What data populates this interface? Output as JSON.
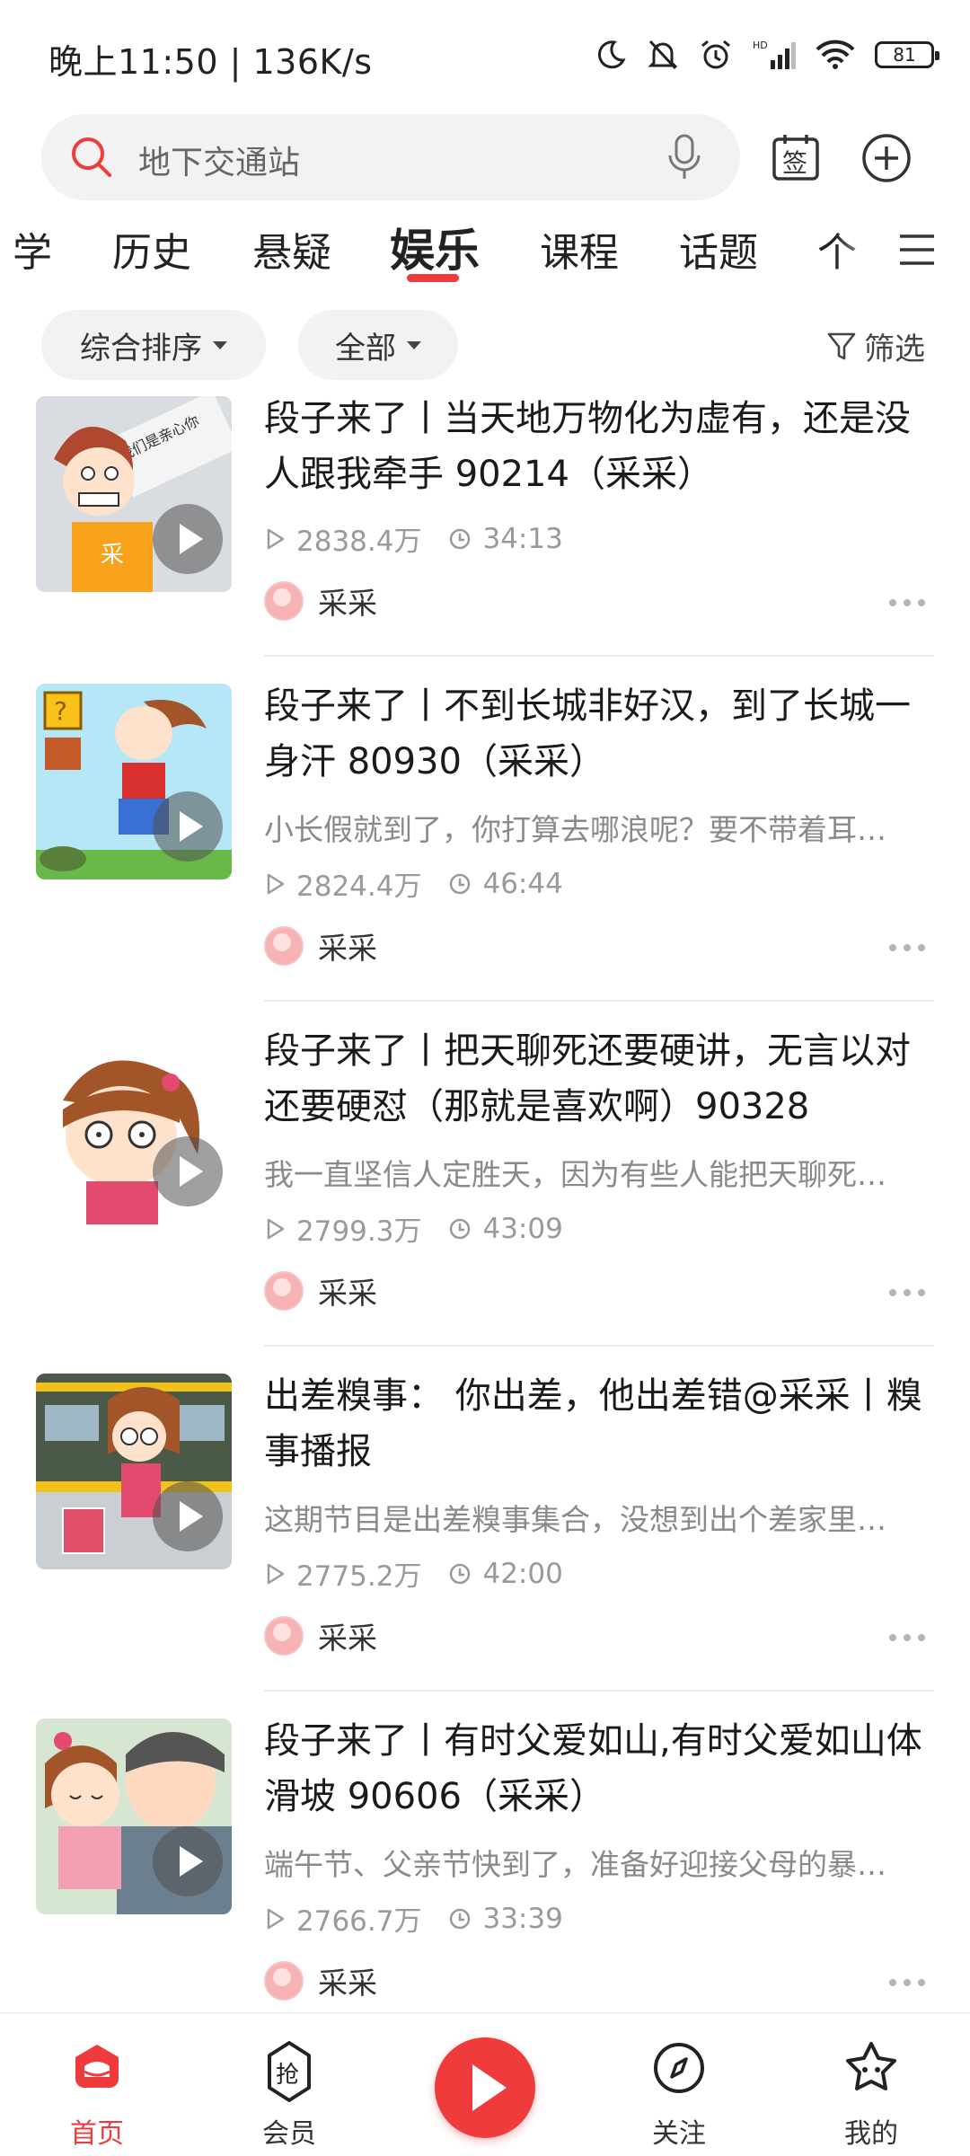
{
  "status_bar": {
    "time_speed": "晚上11:50 | 136K/s",
    "battery": "81",
    "icons": [
      "moon-icon",
      "bell-off-icon",
      "alarm-icon",
      "hd-signal-icon",
      "wifi-icon",
      "battery-icon"
    ]
  },
  "search": {
    "placeholder": "地下交通站",
    "icons": [
      "search-icon",
      "mic-icon",
      "sign-in-icon",
      "add-icon"
    ],
    "sign_label": "签"
  },
  "tabs": {
    "items": [
      "学",
      "历史",
      "悬疑",
      "娱乐",
      "课程",
      "话题",
      "个"
    ],
    "active": "娱乐",
    "accent": "#ef3b3b"
  },
  "filters": {
    "sort": "综合排序",
    "scope": "全部",
    "filter": "筛选"
  },
  "feed": {
    "items": [
      {
        "title": "段子来了丨当天地万物化为虚有，还是没人跟我牵手 90214（采采）",
        "desc": "",
        "plays": "2838.4万",
        "duration": "34:13",
        "author": "采采"
      },
      {
        "title": "段子来了丨不到长城非好汉，到了长城一身汗 80930（采采）",
        "desc": "小长假就到了，你打算去哪浪呢？要不带着耳…",
        "plays": "2824.4万",
        "duration": "46:44",
        "author": "采采"
      },
      {
        "title": "段子来了丨把天聊死还要硬讲，无言以对还要硬怼（那就是喜欢啊）90328",
        "desc": "我一直坚信人定胜天，因为有些人能把天聊死…",
        "plays": "2799.3万",
        "duration": "43:09",
        "author": "采采"
      },
      {
        "title": "出差糗事： 你出差，他出差错@采采丨糗事播报",
        "desc": "这期节目是出差糗事集合，没想到出个差家里…",
        "plays": "2775.2万",
        "duration": "42:00",
        "author": "采采"
      },
      {
        "title": "段子来了丨有时父爱如山,有时父爱如山体滑坡 90606（采采）",
        "desc": "端午节、父亲节快到了，准备好迎接父母的暴…",
        "plays": "2766.7万",
        "duration": "33:39",
        "author": "采采"
      }
    ]
  },
  "bottom_nav": {
    "items": [
      {
        "label": "首页",
        "icon": "home-icon",
        "active": true
      },
      {
        "label": "会员",
        "icon": "vip-grab-icon",
        "active": false
      },
      {
        "label": "",
        "icon": "play-icon",
        "active": false
      },
      {
        "label": "关注",
        "icon": "compass-icon",
        "active": false
      },
      {
        "label": "我的",
        "icon": "profile-star-icon",
        "active": false
      }
    ]
  }
}
